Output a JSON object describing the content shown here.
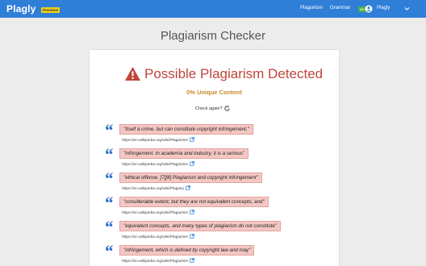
{
  "navbar": {
    "brand": "Plagly",
    "premium_badge": "Premium",
    "links": {
      "plagiarism": "Plagiarism",
      "grammar": "Grammar",
      "grammar_badge": "BETA",
      "user": "Plagly"
    }
  },
  "page": {
    "title": "Plagiarism Checker"
  },
  "result": {
    "alert_title": "Possible Plagiarism Detected",
    "unique_content": "0% Unique Content",
    "check_again": "Check again?"
  },
  "matches": [
    {
      "text": "\"Itself a crime, but can constitute copyright infringement.\"",
      "url": "https://en.wikipedia.org/wiki/Plagiarism"
    },
    {
      "text": "\"infringement. In academia and industry, it is a serious\"",
      "url": "https://en.wikipedia.org/wiki/Plagiarism"
    },
    {
      "text": "\"ethical offense. [7][8] Plagiarism and copyright infringement\"",
      "url": "https://en.wikipedia.org/wiki/Plagiary"
    },
    {
      "text": "\"considerable extent, but they are not equivalent concepts, and\"",
      "url": "https://en.wikipedia.org/wiki/Plagiarism"
    },
    {
      "text": "\"equivalent concepts, and many types of plagiarism do not constitute\"",
      "url": "https://en.wikipedia.org/wiki/Plagiarism"
    },
    {
      "text": "\"infringement, which is defined by copyright law and may\"",
      "url": "https://en.wikipedia.org/wiki/Plagiarism"
    }
  ],
  "colors": {
    "navbar": "#2f7fd8",
    "alert": "#c0453a",
    "unique": "#c98a2c",
    "highlight": "#f4c7c3",
    "quote": "#2f6fc4"
  }
}
